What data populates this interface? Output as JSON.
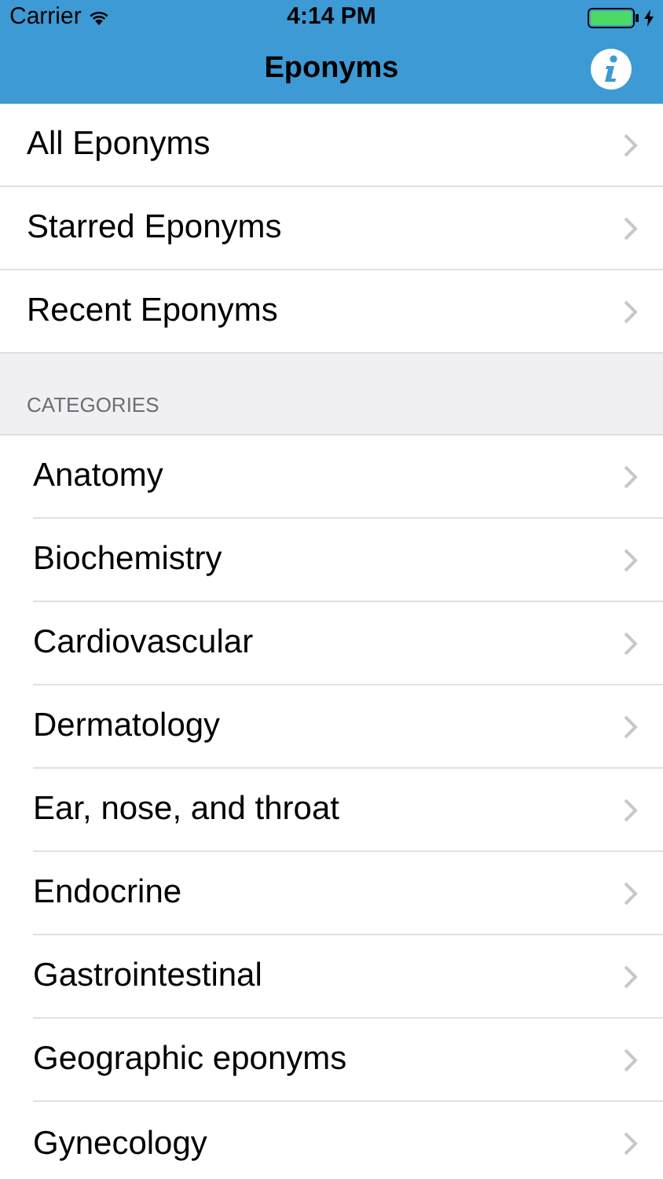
{
  "status_bar": {
    "carrier": "Carrier",
    "time": "4:14 PM"
  },
  "nav_bar": {
    "title": "Eponyms"
  },
  "main_items": [
    {
      "label": "All Eponyms"
    },
    {
      "label": "Starred Eponyms"
    },
    {
      "label": "Recent Eponyms"
    }
  ],
  "categories": {
    "header": "CATEGORIES",
    "items": [
      {
        "label": "Anatomy"
      },
      {
        "label": "Biochemistry"
      },
      {
        "label": "Cardiovascular"
      },
      {
        "label": "Dermatology"
      },
      {
        "label": "Ear, nose, and throat"
      },
      {
        "label": "Endocrine"
      },
      {
        "label": "Gastrointestinal"
      },
      {
        "label": "Geographic eponyms"
      },
      {
        "label": "Gynecology"
      }
    ]
  }
}
